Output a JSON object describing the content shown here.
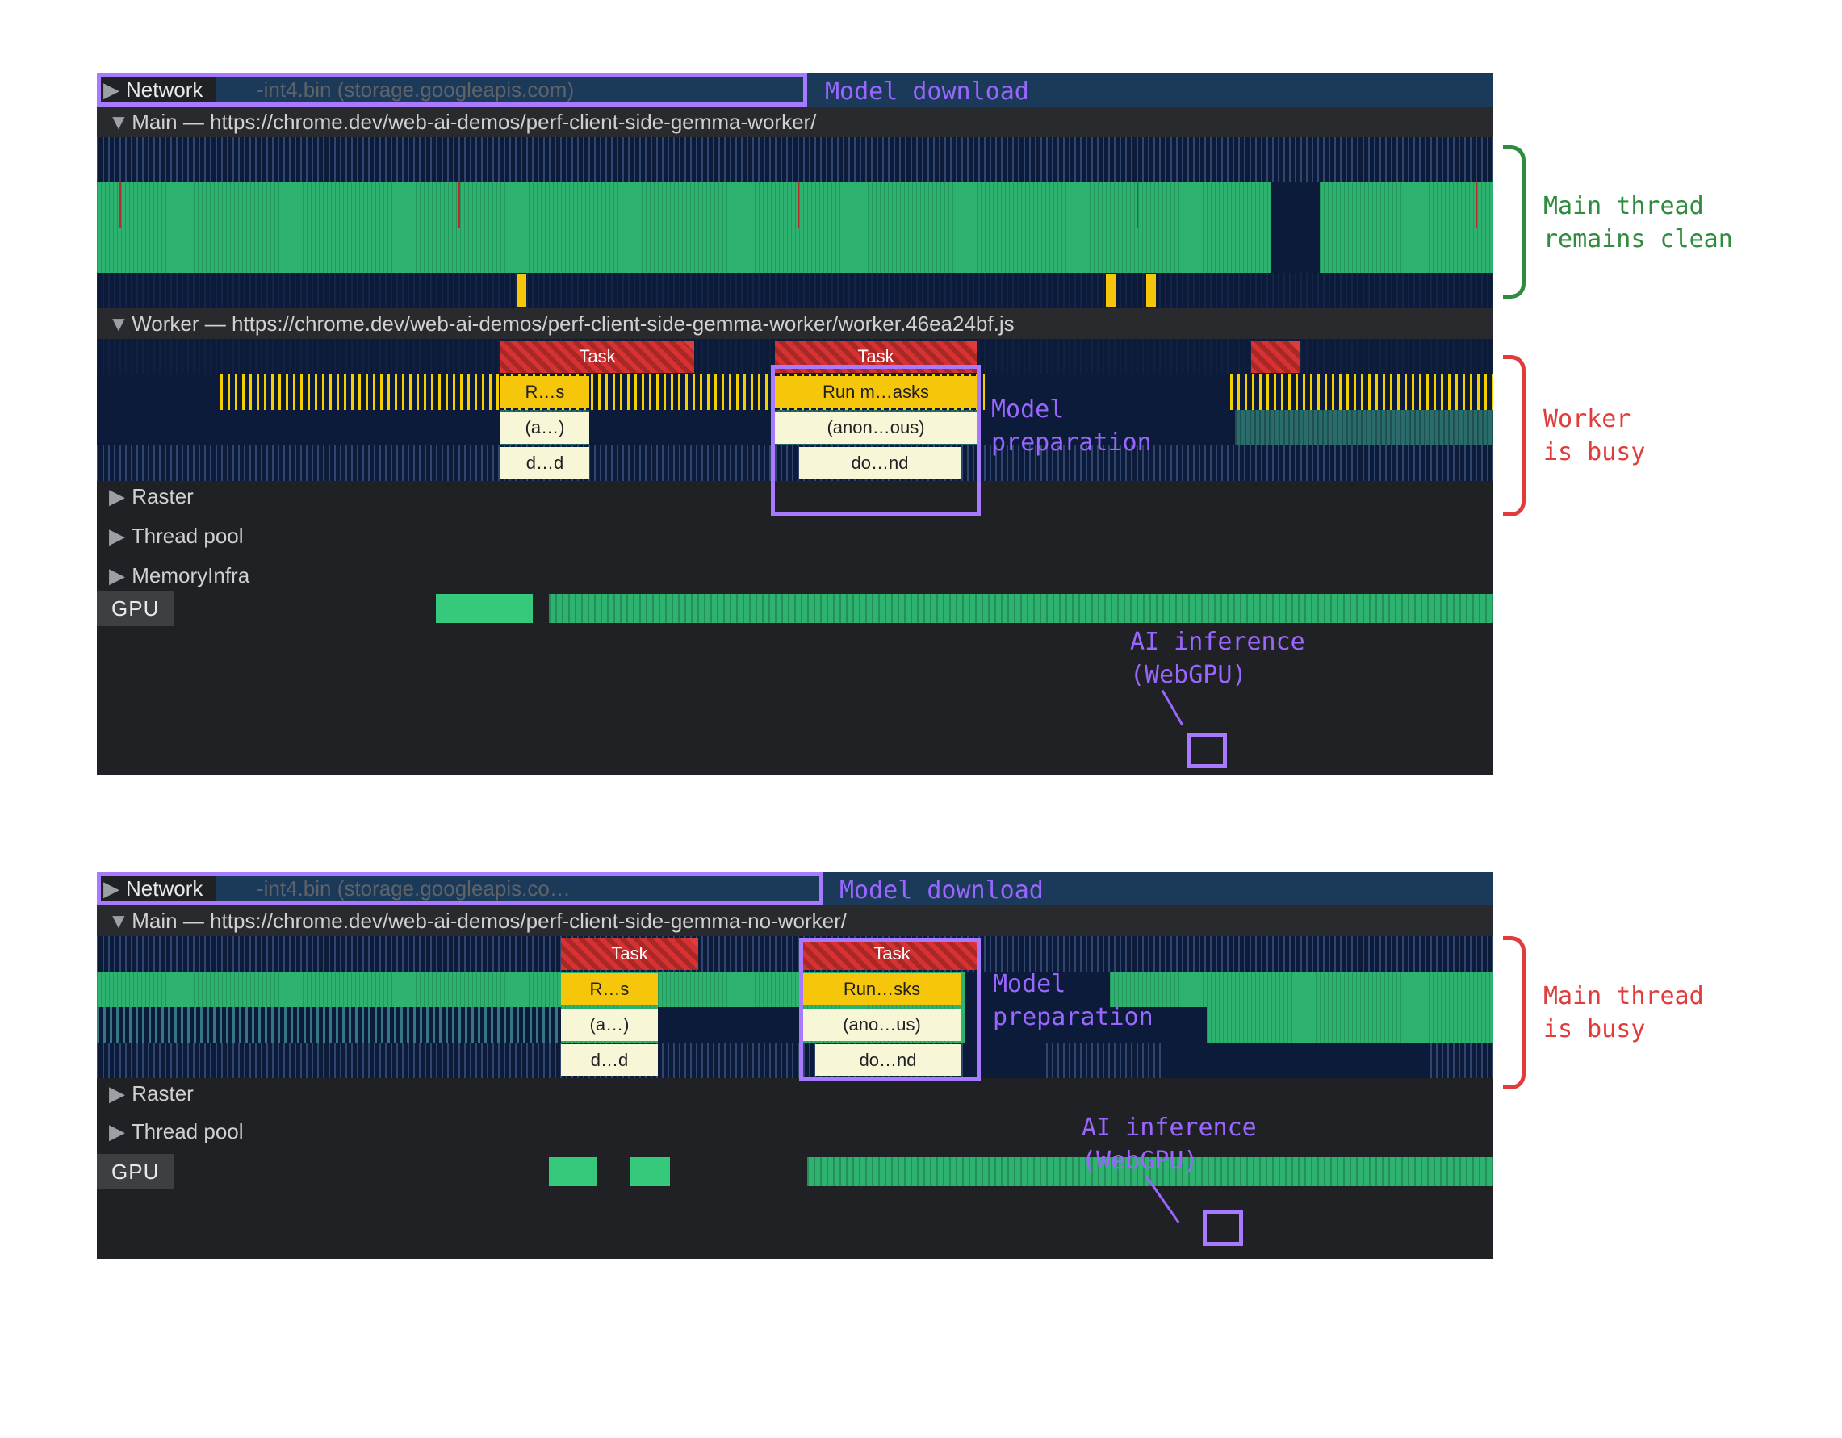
{
  "top": {
    "network_label": "Network",
    "network_file": "-int4.bin (storage.googleapis.com)",
    "model_download": "Model download",
    "main_label": "Main — https://chrome.dev/web-ai-demos/perf-client-side-gemma-worker/",
    "worker_label": "Worker — https://chrome.dev/web-ai-demos/perf-client-side-gemma-worker/worker.46ea24bf.js",
    "task1": "Task",
    "task2": "Task",
    "rs1": "R…s",
    "rs2": "Run m…asks",
    "anon1": "(a…)",
    "anon2": "(anon…ous)",
    "dd1": "d…d",
    "dd2": "do…nd",
    "model_prep": "Model\npreparation",
    "raster": "Raster",
    "threadpool": "Thread pool",
    "memoryinfra": "MemoryInfra",
    "gpu": "GPU",
    "ai_inference": "AI inference\n(WebGPU)",
    "anno_main_clean": "Main thread\nremains clean",
    "anno_worker_busy": "Worker\nis busy"
  },
  "bottom": {
    "network_label": "Network",
    "network_file": "-int4.bin (storage.googleapis.co…",
    "model_download": "Model download",
    "main_label": "Main — https://chrome.dev/web-ai-demos/perf-client-side-gemma-no-worker/",
    "task1": "Task",
    "task2": "Task",
    "rs1": "R…s",
    "rs2": "Run…sks",
    "anon1": "(a…)",
    "anon2": "(ano…us)",
    "dd1": "d…d",
    "dd2": "do…nd",
    "model_prep": "Model\npreparation",
    "raster": "Raster",
    "threadpool": "Thread pool",
    "gpu": "GPU",
    "ai_inference": "AI inference\n(WebGPU)",
    "anno_main_busy": "Main thread\nis busy"
  }
}
